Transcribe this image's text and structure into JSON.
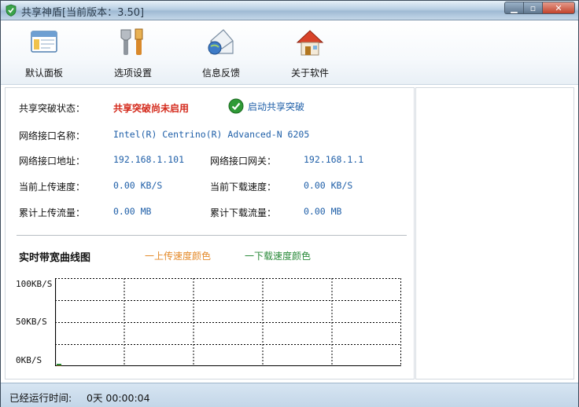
{
  "window": {
    "title": "共享神盾[当前版本：3.50]"
  },
  "toolbar": {
    "items": [
      {
        "label": "默认面板",
        "icon": "browser-window-icon"
      },
      {
        "label": "选项设置",
        "icon": "tools-icon"
      },
      {
        "label": "信息反馈",
        "icon": "feedback-mail-icon"
      },
      {
        "label": "关于软件",
        "icon": "home-icon"
      }
    ]
  },
  "status": {
    "share_label": "共享突破状态：",
    "share_value": "共享突破尚未启用",
    "enable_button": "启动共享突破",
    "nic_name_label": "网络接口名称：",
    "nic_name_value": "Intel(R) Centrino(R) Advanced-N 6205",
    "nic_addr_label": "网络接口地址：",
    "nic_addr_value": "192.168.1.101",
    "gateway_label": "网络接口网关：",
    "gateway_value": "192.168.1.1",
    "up_speed_label": "当前上传速度：",
    "up_speed_value": "0.00 KB/S",
    "down_speed_label": "当前下载速度：",
    "down_speed_value": "0.00 KB/S",
    "up_total_label": "累计上传流量：",
    "up_total_value": "0.00 MB",
    "down_total_label": "累计下载流量：",
    "down_total_value": "0.00 MB"
  },
  "chart": {
    "title": "实时带宽曲线图",
    "legend_up": "一上传速度颜色",
    "legend_down": "一下载速度颜色",
    "y_ticks": [
      "100KB/S",
      "50KB/S",
      "0KB/S"
    ]
  },
  "chart_data": {
    "type": "line",
    "title": "实时带宽曲线图",
    "series": [
      {
        "name": "上传速度",
        "color": "#e48a2a",
        "values": [
          0,
          0
        ]
      },
      {
        "name": "下载速度",
        "color": "#2a8a3a",
        "values": [
          0,
          0
        ]
      }
    ],
    "y_ticks": [
      "100KB/S",
      "50KB/S",
      "0KB/S"
    ],
    "ylim": [
      0,
      100
    ],
    "grid": true
  },
  "statusbar": {
    "label": "已经运行时间:",
    "value": "0天 00:00:04"
  }
}
